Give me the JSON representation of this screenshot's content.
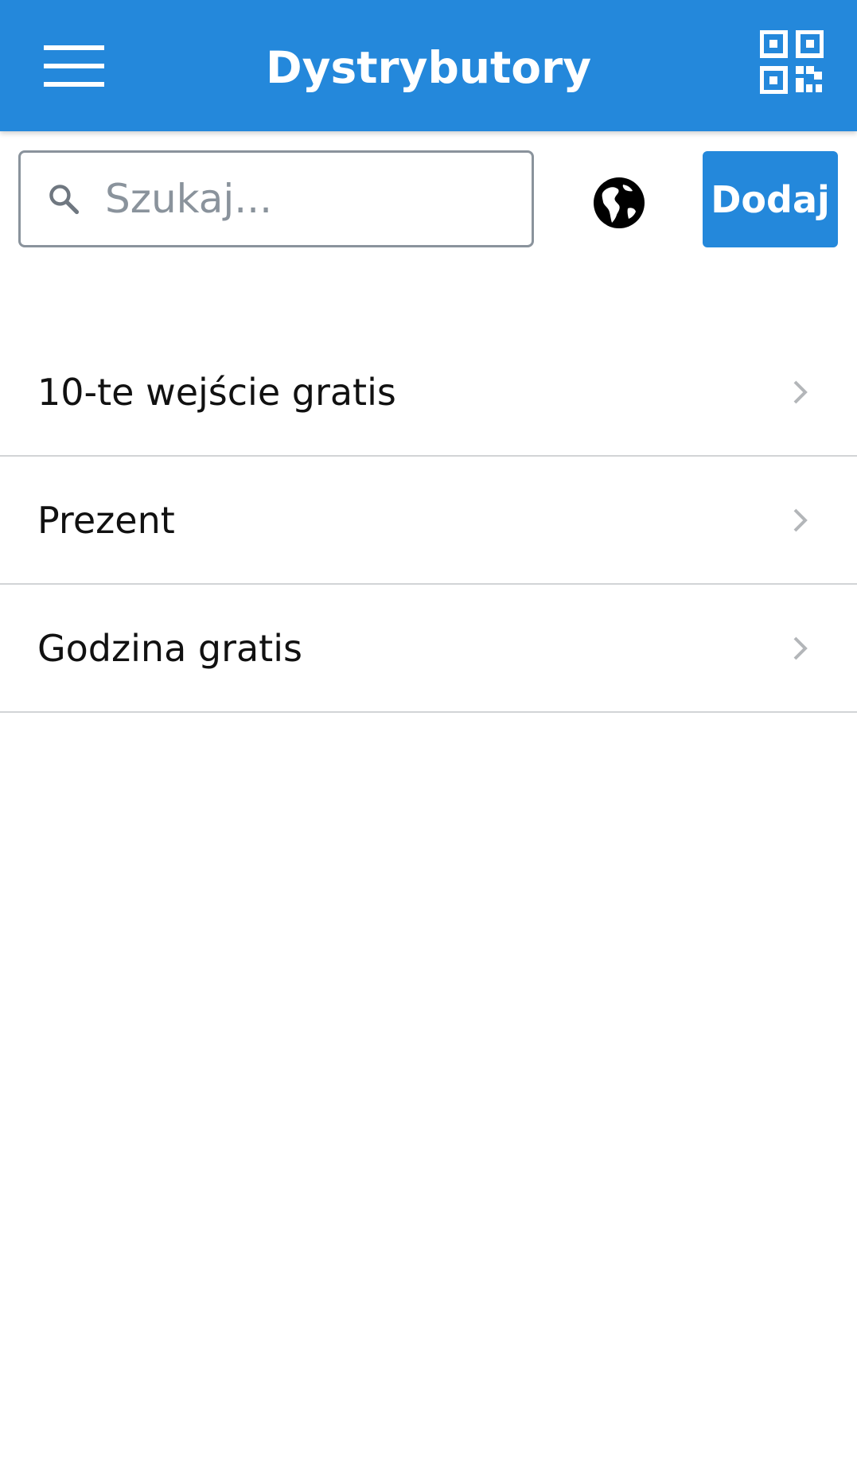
{
  "header": {
    "title": "Dystrybutory",
    "menu_icon": "hamburger-menu-icon",
    "qr_icon": "qr-code-icon",
    "background_color": "#2488db"
  },
  "toolbar": {
    "search": {
      "icon": "search-icon",
      "placeholder": "Szukaj...",
      "value": ""
    },
    "globe_icon": "globe-icon",
    "add_label": "Dodaj",
    "accent_color": "#2488db"
  },
  "list": {
    "items": [
      {
        "label": "10-te wejście gratis",
        "icon": "chevron-right-icon"
      },
      {
        "label": "Prezent",
        "icon": "chevron-right-icon"
      },
      {
        "label": "Godzina gratis",
        "icon": "chevron-right-icon"
      }
    ]
  }
}
